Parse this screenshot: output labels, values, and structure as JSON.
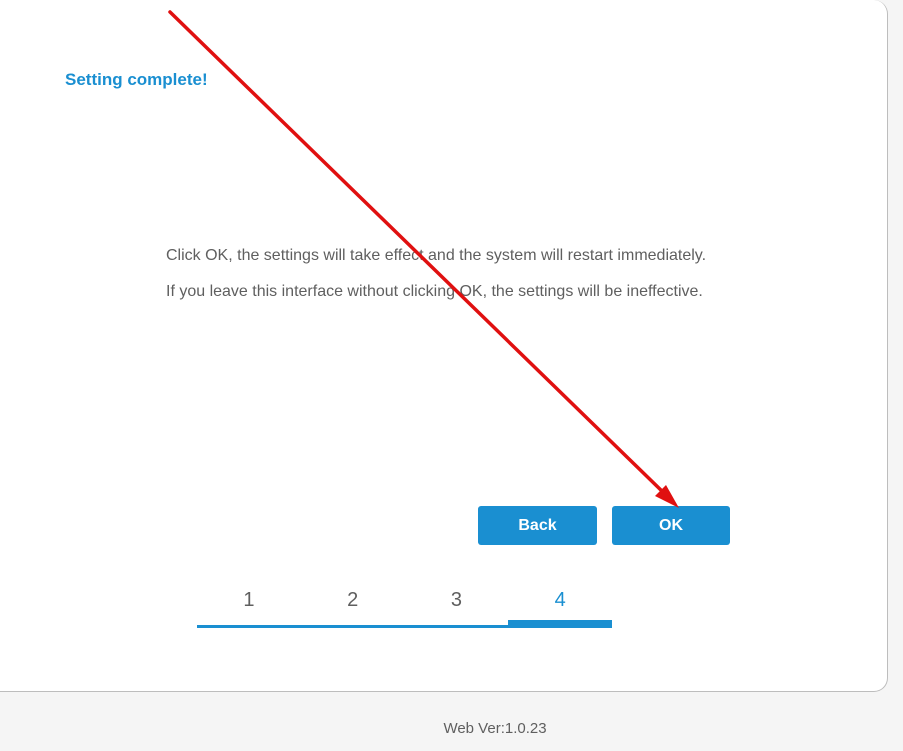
{
  "dialog": {
    "title": "Setting complete!",
    "message_lines": [
      "Click OK, the settings will take effect and the system will restart immediately.",
      "If you leave this interface without clicking OK, the settings will be ineffective."
    ]
  },
  "buttons": {
    "back_label": "Back",
    "ok_label": "OK"
  },
  "stepper": {
    "steps": [
      "1",
      "2",
      "3",
      "4"
    ],
    "current_step": 4
  },
  "footer": {
    "version": "Web Ver:1.0.23"
  },
  "colors": {
    "accent": "#1a8fd1",
    "annotation_arrow": "#e01010",
    "text": "#5f5f5f",
    "background": "#f5f5f5"
  }
}
